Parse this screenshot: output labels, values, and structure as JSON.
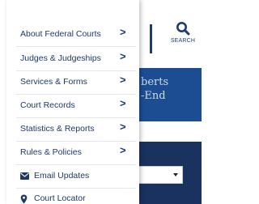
{
  "header": {
    "search_label": "SEARCH",
    "search_icon": "search-icon"
  },
  "hero": {
    "text": "berts\n-End"
  },
  "menu": {
    "items": [
      {
        "label": "About Federal Courts",
        "has_submenu": true
      },
      {
        "label": "Judges & Judgeships",
        "has_submenu": true
      },
      {
        "label": "Services & Forms",
        "has_submenu": true
      },
      {
        "label": "Court Records",
        "has_submenu": true
      },
      {
        "label": "Statistics & Reports",
        "has_submenu": true
      },
      {
        "label": "Rules & Policies",
        "has_submenu": true
      },
      {
        "label": "Email Updates",
        "icon": "envelope-icon",
        "has_submenu": false
      },
      {
        "label": "Court Locator",
        "icon": "map-pin-icon",
        "has_submenu": false
      }
    ],
    "chevron_glyph": ">"
  },
  "colors": {
    "menu_text": "#1d3a66",
    "hero_blue": "#1c4d92",
    "dark_navy": "#1a3260"
  }
}
